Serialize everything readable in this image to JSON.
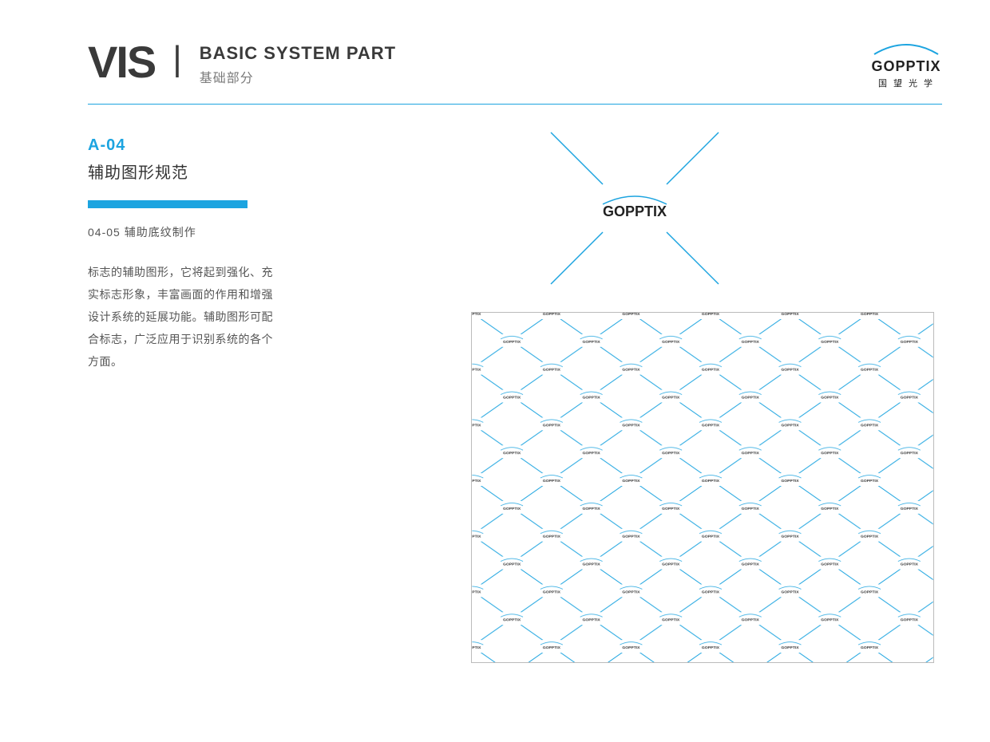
{
  "header": {
    "vis": "VIS",
    "divider": "|",
    "title_en": "BASIC SYSTEM PART",
    "title_cn": "基础部分"
  },
  "brand": {
    "name": "GOPPTIX",
    "cn": "国望光学"
  },
  "section": {
    "code": "A-04",
    "title": "辅助图形规范",
    "sub": "04-05  辅助底纹制作",
    "body": "标志的辅助图形，它将起到强化、充实标志形象，丰富画面的作用和增强设计系统的延展功能。辅助图形可配合标志，广泛应用于识别系统的各个方面。"
  },
  "logo_unit_text": "GOPPTIX",
  "pattern_unit_text": "GOPPTIX",
  "colors": {
    "accent": "#1ca4e0",
    "text_dark": "#3a3a3a"
  }
}
